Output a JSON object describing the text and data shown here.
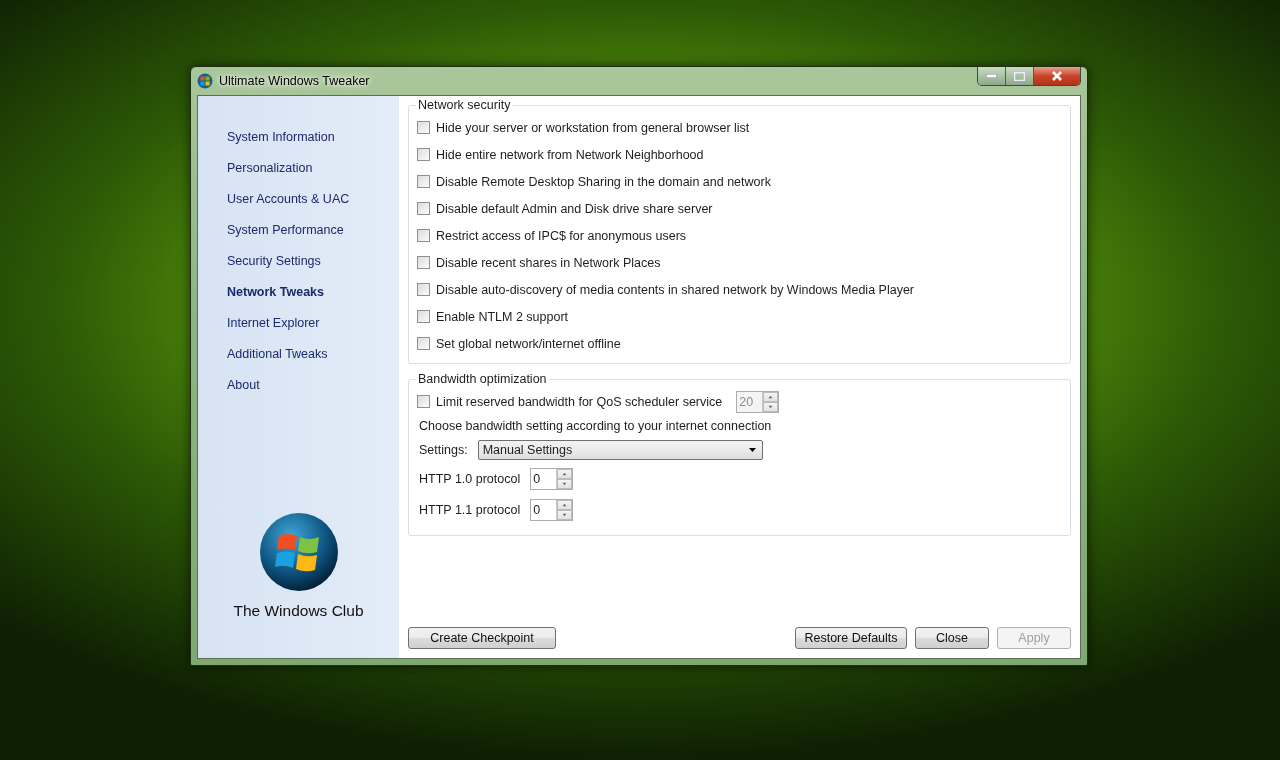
{
  "window": {
    "title": "Ultimate Windows Tweaker"
  },
  "sidebar": {
    "items": [
      {
        "label": "System Information",
        "selected": false
      },
      {
        "label": "Personalization",
        "selected": false
      },
      {
        "label": "User Accounts & UAC",
        "selected": false
      },
      {
        "label": "System Performance",
        "selected": false
      },
      {
        "label": "Security Settings",
        "selected": false
      },
      {
        "label": "Network Tweaks",
        "selected": true
      },
      {
        "label": "Internet Explorer",
        "selected": false
      },
      {
        "label": "Additional Tweaks",
        "selected": false
      },
      {
        "label": "About",
        "selected": false
      }
    ],
    "logo_caption": "The Windows Club"
  },
  "network_security": {
    "title": "Network security",
    "options": [
      {
        "label": "Hide your server or workstation from general browser list",
        "checked": false
      },
      {
        "label": "Hide entire network from Network Neighborhood",
        "checked": false
      },
      {
        "label": "Disable Remote Desktop Sharing in the domain and network",
        "checked": false
      },
      {
        "label": "Disable default Admin and Disk drive share server",
        "checked": false
      },
      {
        "label": "Restrict access of IPC$ for anonymous users",
        "checked": false
      },
      {
        "label": "Disable recent shares in Network Places",
        "checked": false
      },
      {
        "label": "Disable auto-discovery of media contents in shared network by Windows Media Player",
        "checked": false
      },
      {
        "label": "Enable NTLM 2 support",
        "checked": false
      },
      {
        "label": "Set global network/internet offline",
        "checked": false
      }
    ]
  },
  "bandwidth": {
    "title": "Bandwidth optimization",
    "qos": {
      "label": "Limit reserved bandwidth for QoS scheduler service",
      "checked": false,
      "value": "20",
      "disabled": true
    },
    "hint": "Choose bandwidth setting according to your internet connection",
    "settings": {
      "label": "Settings:",
      "value": "Manual Settings"
    },
    "protocols": [
      {
        "label": "HTTP 1.0 protocol",
        "value": "0"
      },
      {
        "label": "HTTP 1.1 protocol",
        "value": "0"
      }
    ]
  },
  "footer": {
    "left_buttons": [
      {
        "label": "Create Checkpoint",
        "disabled": false
      }
    ],
    "right_buttons": [
      {
        "label": "Restore Defaults",
        "disabled": false
      },
      {
        "label": "Close",
        "disabled": false
      },
      {
        "label": "Apply",
        "disabled": true
      }
    ]
  }
}
